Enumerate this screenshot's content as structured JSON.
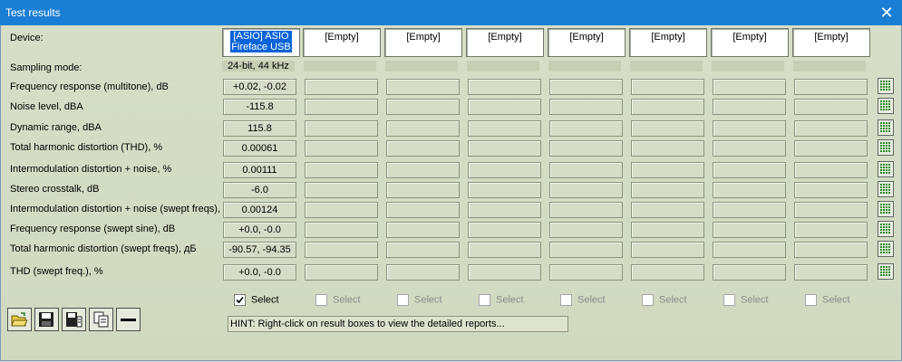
{
  "window": {
    "title": "Test results",
    "close_glyph": "✕"
  },
  "device_label": "Device:",
  "devices": [
    {
      "line1": "[ASIO] ASIO",
      "line2": "Fireface USB",
      "selected": true
    },
    {
      "line1": "[Empty]",
      "line2": ""
    },
    {
      "line1": "[Empty]",
      "line2": ""
    },
    {
      "line1": "[Empty]",
      "line2": ""
    },
    {
      "line1": "[Empty]",
      "line2": ""
    },
    {
      "line1": "[Empty]",
      "line2": ""
    },
    {
      "line1": "[Empty]",
      "line2": ""
    },
    {
      "line1": "[Empty]",
      "line2": ""
    }
  ],
  "sampling": {
    "label": "Sampling mode:",
    "values": [
      "24-bit, 44 kHz",
      "",
      "",
      "",
      "",
      "",
      "",
      ""
    ]
  },
  "rows": [
    {
      "label": "Frequency response (multitone), dB",
      "values": [
        "+0.02, -0.02",
        "",
        "",
        "",
        "",
        "",
        "",
        ""
      ]
    },
    {
      "label": "Noise level, dBA",
      "values": [
        "-115.8",
        "",
        "",
        "",
        "",
        "",
        "",
        ""
      ]
    },
    {
      "label": "Dynamic range, dBA",
      "values": [
        "115.8",
        "",
        "",
        "",
        "",
        "",
        "",
        ""
      ]
    },
    {
      "label": "Total harmonic distortion (THD), %",
      "values": [
        "0.00061",
        "",
        "",
        "",
        "",
        "",
        "",
        ""
      ]
    },
    {
      "label": "Intermodulation distortion + noise, %",
      "values": [
        "0.00111",
        "",
        "",
        "",
        "",
        "",
        "",
        ""
      ]
    },
    {
      "label": "Stereo crosstalk, dB",
      "values": [
        "-6.0",
        "",
        "",
        "",
        "",
        "",
        "",
        ""
      ]
    },
    {
      "label": "Intermodulation distortion + noise (swept freqs), %",
      "values": [
        "0.00124",
        "",
        "",
        "",
        "",
        "",
        "",
        ""
      ]
    },
    {
      "label": "Frequency response (swept sine), dB",
      "values": [
        "+0.0, -0.0",
        "",
        "",
        "",
        "",
        "",
        "",
        ""
      ]
    },
    {
      "label": "Total harmonic distortion (swept freqs), дБ",
      "values": [
        "-90.57, -94.35",
        "",
        "",
        "",
        "",
        "",
        "",
        ""
      ]
    },
    {
      "label": "THD (swept freq.), %",
      "values": [
        "+0.0, -0.0",
        "",
        "",
        "",
        "",
        "",
        "",
        ""
      ]
    }
  ],
  "select": {
    "label": "Select",
    "checked": [
      true,
      false,
      false,
      false,
      false,
      false,
      false,
      false
    ]
  },
  "toolbar": [
    {
      "name": "open-folder-icon"
    },
    {
      "name": "save-icon"
    },
    {
      "name": "save-report-icon"
    },
    {
      "name": "copy-icon"
    },
    {
      "name": "remove-icon"
    }
  ],
  "hint": "HINT: Right-click on result boxes to view the detailed reports...",
  "colors": {
    "titlebar": "#1a7fd4",
    "background": "#d4dcc4",
    "selection": "#0a64d8",
    "grid_icon": "#2a8a2a"
  }
}
